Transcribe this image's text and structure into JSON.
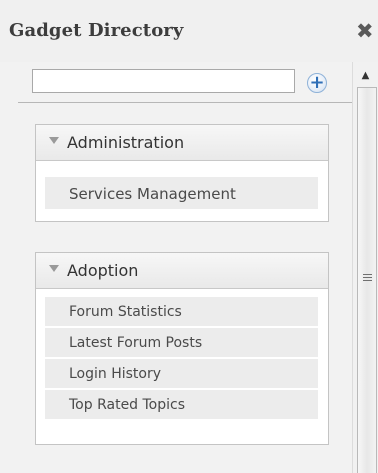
{
  "window": {
    "title": "Gadget Directory",
    "close_glyph": "✖"
  },
  "search": {
    "value": "",
    "placeholder": "",
    "add_glyph": "+"
  },
  "scrollbar": {
    "up_glyph": "▲"
  },
  "groups": [
    {
      "title": "Administration",
      "items": [
        "Services Management"
      ]
    },
    {
      "title": "Adoption",
      "items": [
        "Forum Statistics",
        "Latest Forum Posts",
        "Login History",
        "Top Rated Topics"
      ]
    }
  ],
  "icons": {
    "close": "close-icon",
    "add": "plus-icon",
    "group_toggle": "triangle-down-icon",
    "scroll_up": "arrow-up-icon",
    "scroll_grip": "grip-icon"
  },
  "colors": {
    "accent": "#2f6fb7",
    "title": "#3d3d3d",
    "panel_bg": "#f2f2f2",
    "item_bg": "#ececec"
  }
}
